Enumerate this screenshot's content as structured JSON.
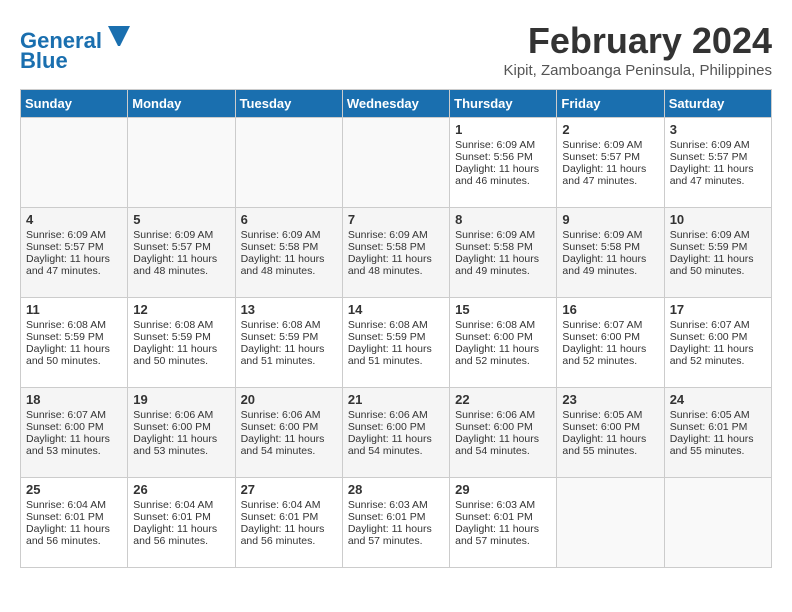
{
  "logo": {
    "line1": "General",
    "line2": "Blue"
  },
  "title": "February 2024",
  "location": "Kipit, Zamboanga Peninsula, Philippines",
  "days_of_week": [
    "Sunday",
    "Monday",
    "Tuesday",
    "Wednesday",
    "Thursday",
    "Friday",
    "Saturday"
  ],
  "weeks": [
    [
      {
        "day": "",
        "sunrise": "",
        "sunset": "",
        "daylight": ""
      },
      {
        "day": "",
        "sunrise": "",
        "sunset": "",
        "daylight": ""
      },
      {
        "day": "",
        "sunrise": "",
        "sunset": "",
        "daylight": ""
      },
      {
        "day": "",
        "sunrise": "",
        "sunset": "",
        "daylight": ""
      },
      {
        "day": "1",
        "sunrise": "Sunrise: 6:09 AM",
        "sunset": "Sunset: 5:56 PM",
        "daylight": "Daylight: 11 hours and 46 minutes."
      },
      {
        "day": "2",
        "sunrise": "Sunrise: 6:09 AM",
        "sunset": "Sunset: 5:57 PM",
        "daylight": "Daylight: 11 hours and 47 minutes."
      },
      {
        "day": "3",
        "sunrise": "Sunrise: 6:09 AM",
        "sunset": "Sunset: 5:57 PM",
        "daylight": "Daylight: 11 hours and 47 minutes."
      }
    ],
    [
      {
        "day": "4",
        "sunrise": "Sunrise: 6:09 AM",
        "sunset": "Sunset: 5:57 PM",
        "daylight": "Daylight: 11 hours and 47 minutes."
      },
      {
        "day": "5",
        "sunrise": "Sunrise: 6:09 AM",
        "sunset": "Sunset: 5:57 PM",
        "daylight": "Daylight: 11 hours and 48 minutes."
      },
      {
        "day": "6",
        "sunrise": "Sunrise: 6:09 AM",
        "sunset": "Sunset: 5:58 PM",
        "daylight": "Daylight: 11 hours and 48 minutes."
      },
      {
        "day": "7",
        "sunrise": "Sunrise: 6:09 AM",
        "sunset": "Sunset: 5:58 PM",
        "daylight": "Daylight: 11 hours and 48 minutes."
      },
      {
        "day": "8",
        "sunrise": "Sunrise: 6:09 AM",
        "sunset": "Sunset: 5:58 PM",
        "daylight": "Daylight: 11 hours and 49 minutes."
      },
      {
        "day": "9",
        "sunrise": "Sunrise: 6:09 AM",
        "sunset": "Sunset: 5:58 PM",
        "daylight": "Daylight: 11 hours and 49 minutes."
      },
      {
        "day": "10",
        "sunrise": "Sunrise: 6:09 AM",
        "sunset": "Sunset: 5:59 PM",
        "daylight": "Daylight: 11 hours and 50 minutes."
      }
    ],
    [
      {
        "day": "11",
        "sunrise": "Sunrise: 6:08 AM",
        "sunset": "Sunset: 5:59 PM",
        "daylight": "Daylight: 11 hours and 50 minutes."
      },
      {
        "day": "12",
        "sunrise": "Sunrise: 6:08 AM",
        "sunset": "Sunset: 5:59 PM",
        "daylight": "Daylight: 11 hours and 50 minutes."
      },
      {
        "day": "13",
        "sunrise": "Sunrise: 6:08 AM",
        "sunset": "Sunset: 5:59 PM",
        "daylight": "Daylight: 11 hours and 51 minutes."
      },
      {
        "day": "14",
        "sunrise": "Sunrise: 6:08 AM",
        "sunset": "Sunset: 5:59 PM",
        "daylight": "Daylight: 11 hours and 51 minutes."
      },
      {
        "day": "15",
        "sunrise": "Sunrise: 6:08 AM",
        "sunset": "Sunset: 6:00 PM",
        "daylight": "Daylight: 11 hours and 52 minutes."
      },
      {
        "day": "16",
        "sunrise": "Sunrise: 6:07 AM",
        "sunset": "Sunset: 6:00 PM",
        "daylight": "Daylight: 11 hours and 52 minutes."
      },
      {
        "day": "17",
        "sunrise": "Sunrise: 6:07 AM",
        "sunset": "Sunset: 6:00 PM",
        "daylight": "Daylight: 11 hours and 52 minutes."
      }
    ],
    [
      {
        "day": "18",
        "sunrise": "Sunrise: 6:07 AM",
        "sunset": "Sunset: 6:00 PM",
        "daylight": "Daylight: 11 hours and 53 minutes."
      },
      {
        "day": "19",
        "sunrise": "Sunrise: 6:06 AM",
        "sunset": "Sunset: 6:00 PM",
        "daylight": "Daylight: 11 hours and 53 minutes."
      },
      {
        "day": "20",
        "sunrise": "Sunrise: 6:06 AM",
        "sunset": "Sunset: 6:00 PM",
        "daylight": "Daylight: 11 hours and 54 minutes."
      },
      {
        "day": "21",
        "sunrise": "Sunrise: 6:06 AM",
        "sunset": "Sunset: 6:00 PM",
        "daylight": "Daylight: 11 hours and 54 minutes."
      },
      {
        "day": "22",
        "sunrise": "Sunrise: 6:06 AM",
        "sunset": "Sunset: 6:00 PM",
        "daylight": "Daylight: 11 hours and 54 minutes."
      },
      {
        "day": "23",
        "sunrise": "Sunrise: 6:05 AM",
        "sunset": "Sunset: 6:00 PM",
        "daylight": "Daylight: 11 hours and 55 minutes."
      },
      {
        "day": "24",
        "sunrise": "Sunrise: 6:05 AM",
        "sunset": "Sunset: 6:01 PM",
        "daylight": "Daylight: 11 hours and 55 minutes."
      }
    ],
    [
      {
        "day": "25",
        "sunrise": "Sunrise: 6:04 AM",
        "sunset": "Sunset: 6:01 PM",
        "daylight": "Daylight: 11 hours and 56 minutes."
      },
      {
        "day": "26",
        "sunrise": "Sunrise: 6:04 AM",
        "sunset": "Sunset: 6:01 PM",
        "daylight": "Daylight: 11 hours and 56 minutes."
      },
      {
        "day": "27",
        "sunrise": "Sunrise: 6:04 AM",
        "sunset": "Sunset: 6:01 PM",
        "daylight": "Daylight: 11 hours and 56 minutes."
      },
      {
        "day": "28",
        "sunrise": "Sunrise: 6:03 AM",
        "sunset": "Sunset: 6:01 PM",
        "daylight": "Daylight: 11 hours and 57 minutes."
      },
      {
        "day": "29",
        "sunrise": "Sunrise: 6:03 AM",
        "sunset": "Sunset: 6:01 PM",
        "daylight": "Daylight: 11 hours and 57 minutes."
      },
      {
        "day": "",
        "sunrise": "",
        "sunset": "",
        "daylight": ""
      },
      {
        "day": "",
        "sunrise": "",
        "sunset": "",
        "daylight": ""
      }
    ]
  ]
}
